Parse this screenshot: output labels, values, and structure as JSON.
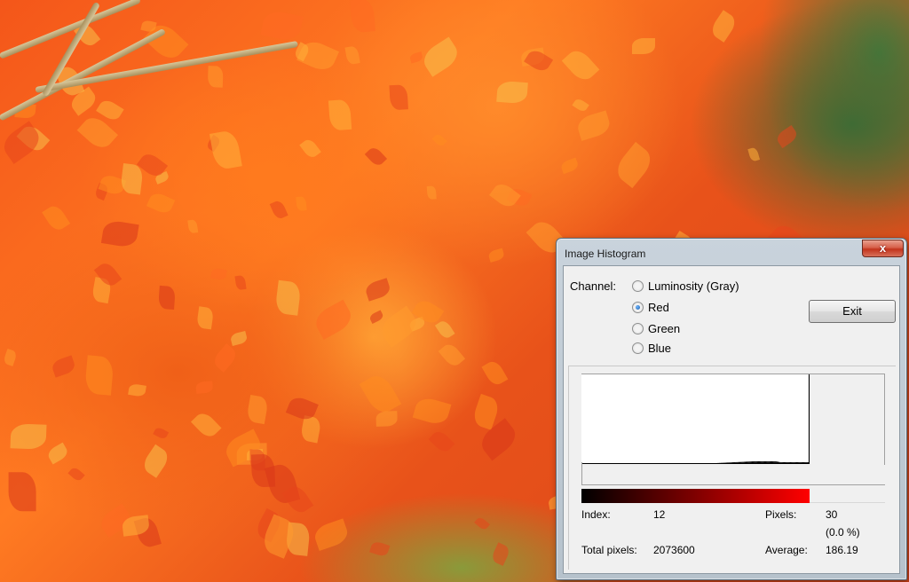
{
  "dialog": {
    "title": "Image Histogram",
    "close_symbol": "x",
    "channel_label": "Channel:",
    "channels": [
      {
        "label": "Luminosity (Gray)",
        "checked": false
      },
      {
        "label": "Red",
        "checked": true
      },
      {
        "label": "Green",
        "checked": false
      },
      {
        "label": "Blue",
        "checked": false
      }
    ],
    "exit_label": "Exit",
    "stats": {
      "index_label": "Index:",
      "index_value": "12",
      "pixels_label": "Pixels:",
      "pixels_value": "30",
      "percent_value": "(0.0 %)",
      "total_label": "Total pixels:",
      "total_value": "2073600",
      "average_label": "Average:",
      "average_value": "186.19"
    }
  },
  "colors": {
    "gradient_start": "#000000",
    "gradient_end": "#ff0000"
  },
  "chart_data": {
    "type": "area",
    "x_range": [
      0,
      255
    ],
    "note_series": "channel histogram counts (relative, 0-1)",
    "values": [
      0,
      0,
      0,
      0,
      0,
      0,
      0,
      0,
      0,
      0,
      0,
      0,
      0,
      0,
      0,
      0,
      0,
      0,
      0,
      0,
      0,
      0,
      0,
      0,
      0,
      0,
      0,
      0,
      0,
      0,
      0,
      0,
      0,
      0,
      0,
      0,
      0,
      0,
      0,
      0,
      0,
      0,
      0,
      0,
      0,
      0,
      0,
      0,
      0,
      0,
      0,
      0,
      0,
      0,
      0,
      0,
      0,
      0,
      0,
      0,
      0,
      0,
      0,
      0,
      0,
      0,
      0,
      0,
      0,
      0,
      0,
      0,
      0,
      0,
      0,
      0,
      0,
      0,
      0,
      0,
      0,
      0,
      0,
      0,
      0,
      0,
      0,
      0,
      0,
      0,
      0,
      0,
      0,
      0,
      0,
      0,
      0,
      0,
      0,
      0,
      0,
      0,
      0,
      0,
      0,
      0,
      0,
      0,
      0,
      0,
      0,
      0,
      0,
      0,
      0,
      0,
      0,
      0,
      0,
      0,
      0,
      0,
      0,
      0,
      0.002,
      0.002,
      0.003,
      0.003,
      0.004,
      0.004,
      0.005,
      0.005,
      0.006,
      0.006,
      0.007,
      0.007,
      0.008,
      0.008,
      0.009,
      0.009,
      0.01,
      0.01,
      0.011,
      0.011,
      0.012,
      0.012,
      0.013,
      0.013,
      0.014,
      0.014,
      0.015,
      0.015,
      0.016,
      0.016,
      0.017,
      0.017,
      0.018,
      0.018,
      0.019,
      0.019,
      0.02,
      0.02,
      0.021,
      0.021,
      0.022,
      0.022,
      0.023,
      0.023,
      0.024,
      0.024,
      0.025,
      0.025,
      0.026,
      0.026,
      0.027,
      0.027,
      0.028,
      0.028,
      0.029,
      0.029,
      0.03,
      0.03,
      0.03,
      0.03,
      0.03,
      0.03,
      0.03,
      0.03,
      0.03,
      0.03,
      0.03,
      0.03,
      0.03,
      0.03,
      0.03,
      0.03,
      0.03,
      0.03,
      0.03,
      0.03,
      0.03,
      0.03,
      0.03,
      0.03,
      0.028,
      0.026,
      0.024,
      0.022,
      0.02,
      0.02,
      0.02,
      0.02,
      0.02,
      0.02,
      0.02,
      0.02,
      0.02,
      0.02,
      0.02,
      0.02,
      0.02,
      0.02,
      0.02,
      0.02,
      0.02,
      0.02,
      0.02,
      0.02,
      0.02,
      0.02,
      0.02,
      0.02,
      0.02,
      0.02,
      0.02,
      0.02,
      0.02,
      0.02,
      1.0
    ]
  }
}
